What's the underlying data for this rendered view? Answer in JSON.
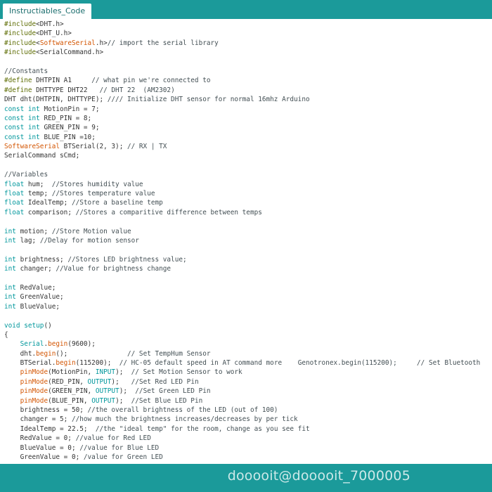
{
  "window": {
    "tab_title": "Instructiables_Code"
  },
  "editor": {
    "lines": [
      [
        [
          "pre",
          "#include"
        ],
        [
          "",
          "<DHT.h>"
        ]
      ],
      [
        [
          "pre",
          "#include"
        ],
        [
          "",
          "<DHT_U.h>"
        ]
      ],
      [
        [
          "pre",
          "#include"
        ],
        [
          "",
          "<"
        ],
        [
          "fn",
          "SoftwareSerial"
        ],
        [
          "",
          ".h>"
        ],
        [
          "cm",
          "// import the serial library"
        ]
      ],
      [
        [
          "pre",
          "#include"
        ],
        [
          "",
          "<SerialCommand.h>"
        ]
      ],
      [],
      [
        [
          "cm",
          "//Constants"
        ]
      ],
      [
        [
          "pre",
          "#define"
        ],
        [
          "",
          " DHTPIN A1     "
        ],
        [
          "cm",
          "// what pin we're connected to"
        ]
      ],
      [
        [
          "pre",
          "#define"
        ],
        [
          "",
          " DHTTYPE DHT22   "
        ],
        [
          "cm",
          "// DHT 22  (AM2302)"
        ]
      ],
      [
        [
          "",
          "DHT dht(DHTPIN, DHTTYPE); "
        ],
        [
          "cm",
          "//// Initialize DHT sensor for normal 16mhz Arduino"
        ]
      ],
      [
        [
          "ty",
          "const"
        ],
        [
          "",
          " "
        ],
        [
          "ty",
          "int"
        ],
        [
          "",
          " MotionPin = 7;"
        ]
      ],
      [
        [
          "ty",
          "const"
        ],
        [
          "",
          " "
        ],
        [
          "ty",
          "int"
        ],
        [
          "",
          " RED_PIN = 8;"
        ]
      ],
      [
        [
          "ty",
          "const"
        ],
        [
          "",
          " "
        ],
        [
          "ty",
          "int"
        ],
        [
          "",
          " GREEN_PIN = 9;"
        ]
      ],
      [
        [
          "ty",
          "const"
        ],
        [
          "",
          " "
        ],
        [
          "ty",
          "int"
        ],
        [
          "",
          " BLUE_PIN =10;"
        ]
      ],
      [
        [
          "fn",
          "SoftwareSerial"
        ],
        [
          "",
          " BTSerial(2, 3); "
        ],
        [
          "cm",
          "// RX | TX"
        ]
      ],
      [
        [
          "",
          "SerialCommand sCmd;"
        ]
      ],
      [],
      [
        [
          "cm",
          "//Variables"
        ]
      ],
      [
        [
          "ty",
          "float"
        ],
        [
          "",
          " hum;  "
        ],
        [
          "cm",
          "//Stores humidity value"
        ]
      ],
      [
        [
          "ty",
          "float"
        ],
        [
          "",
          " temp; "
        ],
        [
          "cm",
          "//Stores temperature value"
        ]
      ],
      [
        [
          "ty",
          "float"
        ],
        [
          "",
          " IdealTemp; "
        ],
        [
          "cm",
          "//Store a baseline temp"
        ]
      ],
      [
        [
          "ty",
          "float"
        ],
        [
          "",
          " comparison; "
        ],
        [
          "cm",
          "//Stores a comparitive difference between temps"
        ]
      ],
      [],
      [
        [
          "ty",
          "int"
        ],
        [
          "",
          " motion; "
        ],
        [
          "cm",
          "//Store Motion value"
        ]
      ],
      [
        [
          "ty",
          "int"
        ],
        [
          "",
          " lag; "
        ],
        [
          "cm",
          "//Delay for motion sensor"
        ]
      ],
      [],
      [
        [
          "ty",
          "int"
        ],
        [
          "",
          " brightness; "
        ],
        [
          "cm",
          "//Stores LED brightness value;"
        ]
      ],
      [
        [
          "ty",
          "int"
        ],
        [
          "",
          " changer; "
        ],
        [
          "cm",
          "//Value for brightness change"
        ]
      ],
      [],
      [
        [
          "ty",
          "int"
        ],
        [
          "",
          " RedValue;"
        ]
      ],
      [
        [
          "ty",
          "int"
        ],
        [
          "",
          " GreenValue;"
        ]
      ],
      [
        [
          "ty",
          "int"
        ],
        [
          "",
          " BlueValue;"
        ]
      ],
      [],
      [
        [
          "ty",
          "void"
        ],
        [
          "",
          " "
        ],
        [
          "kw",
          "setup"
        ],
        [
          "",
          "()"
        ]
      ],
      [
        [
          "",
          "{"
        ]
      ],
      [
        [
          "",
          "    "
        ],
        [
          "kw",
          "Serial"
        ],
        [
          "",
          "."
        ],
        [
          "fn",
          "begin"
        ],
        [
          "",
          "(9600);"
        ]
      ],
      [
        [
          "",
          "    dht."
        ],
        [
          "fn",
          "begin"
        ],
        [
          "",
          "();               "
        ],
        [
          "cm",
          "// Set TempHum Sensor"
        ]
      ],
      [
        [
          "",
          "    BTSerial."
        ],
        [
          "fn",
          "begin"
        ],
        [
          "",
          "(115200);  "
        ],
        [
          "cm",
          "// HC-05 default speed in AT command more    Genotronex.begin(115200);     // Set Bluetooth"
        ]
      ],
      [
        [
          "",
          "    "
        ],
        [
          "fn",
          "pinMode"
        ],
        [
          "",
          "(MotionPin, "
        ],
        [
          "kw",
          "INPUT"
        ],
        [
          "",
          "); "
        ],
        [
          "cm",
          " // Set Motion Sensor to work"
        ]
      ],
      [
        [
          "",
          "    "
        ],
        [
          "fn",
          "pinMode"
        ],
        [
          "",
          "(RED_PIN, "
        ],
        [
          "kw",
          "OUTPUT"
        ],
        [
          "",
          ");   "
        ],
        [
          "cm",
          "//Set Red LED Pin"
        ]
      ],
      [
        [
          "",
          "    "
        ],
        [
          "fn",
          "pinMode"
        ],
        [
          "",
          "(GREEN_PIN, "
        ],
        [
          "kw",
          "OUTPUT"
        ],
        [
          "",
          ");  "
        ],
        [
          "cm",
          "//Set Green LED Pin"
        ]
      ],
      [
        [
          "",
          "    "
        ],
        [
          "fn",
          "pinMode"
        ],
        [
          "",
          "(BLUE_PIN, "
        ],
        [
          "kw",
          "OUTPUT"
        ],
        [
          "",
          ");  "
        ],
        [
          "cm",
          "//Set Blue LED Pin"
        ]
      ],
      [
        [
          "",
          "    brightness = 50; "
        ],
        [
          "cm",
          "//the overall brightness of the LED (out of 100)"
        ]
      ],
      [
        [
          "",
          "    changer = 5; "
        ],
        [
          "cm",
          "//how much the brightness increases/decreases by per tick"
        ]
      ],
      [
        [
          "",
          "    IdealTemp = 22.5;  "
        ],
        [
          "cm",
          "//the \"ideal temp\" for the room, change as you see fit"
        ]
      ],
      [
        [
          "",
          "    RedValue = 0; "
        ],
        [
          "cm",
          "//value for Red LED"
        ]
      ],
      [
        [
          "",
          "    BlueValue = 0; "
        ],
        [
          "cm",
          "//value for Blue LED"
        ]
      ],
      [
        [
          "",
          "    GreenValue = 0; "
        ],
        [
          "cm",
          "/value for Green LED"
        ]
      ]
    ]
  },
  "footer": {
    "watermark": "dooooit@dooooit_7000005"
  },
  "colors": {
    "accent": "#1b9a9a",
    "keyword": "#00979c",
    "function": "#d35400",
    "preprocessor": "#5e6d03",
    "comment": "#434f54"
  }
}
